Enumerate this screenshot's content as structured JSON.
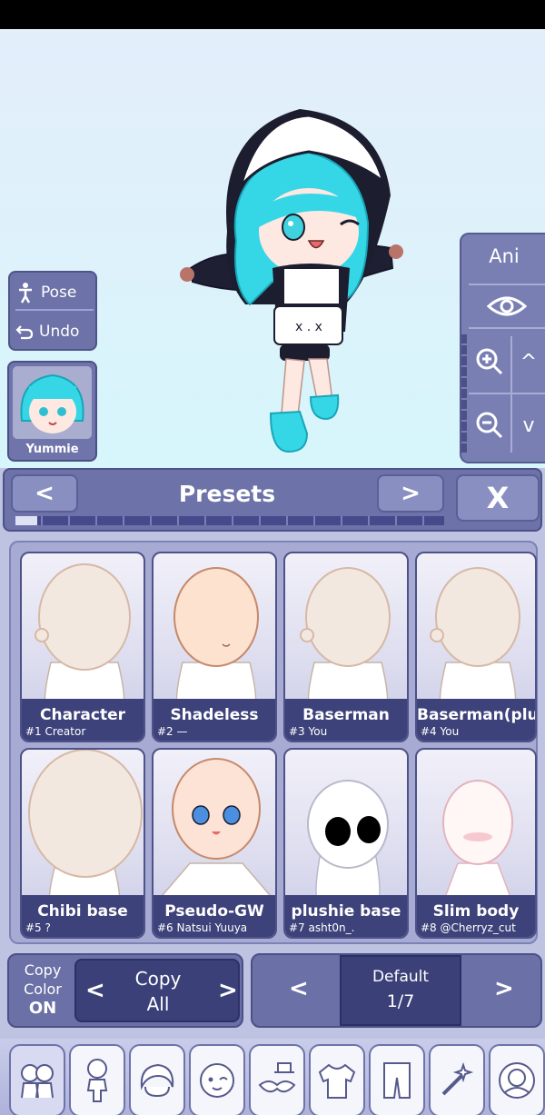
{
  "stage": {
    "pose_label": "Pose",
    "undo_label": "Undo",
    "character_name": "Yummie",
    "ani_label": "Ani",
    "up_glyph": "^",
    "down_glyph": "v"
  },
  "panel": {
    "title": "Presets",
    "prev_glyph": "<",
    "next_glyph": ">",
    "close_glyph": "X",
    "presets": [
      {
        "name": "Character",
        "num": "#1 Creator"
      },
      {
        "name": "Shadeless",
        "num": "#2 —"
      },
      {
        "name": "Baserman",
        "num": "#3 You"
      },
      {
        "name": "Baserman(plu",
        "num": "#4 You"
      },
      {
        "name": "Chibi base",
        "num": "#5 ?"
      },
      {
        "name": "Pseudo-GW",
        "num": "#6 Natsui Yuuya"
      },
      {
        "name": "plushie base",
        "num": "#7 asht0n_."
      },
      {
        "name": "Slim body",
        "num": "#8 @Cherryz_cut"
      }
    ]
  },
  "copy": {
    "copy_color_line1": "Copy",
    "copy_color_line2": "Color",
    "copy_color_state": "ON",
    "copy_all_line1": "Copy",
    "copy_all_line2": "All",
    "left_glyph": "<",
    "right_glyph": ">"
  },
  "default_selector": {
    "label": "Default",
    "page": "1/7",
    "left_glyph": "<",
    "right_glyph": ">"
  },
  "tabs": [
    "presets-tab-icon",
    "body-tab-icon",
    "hair-tab-icon",
    "face-tab-icon",
    "accessory-tab-icon",
    "clothing-tab-icon",
    "pants-tab-icon",
    "props-tab-icon",
    "profile-tab-icon"
  ],
  "colors": {
    "accent": "#6d72a8",
    "dark": "#3d427a",
    "hair": "#35d7e6"
  }
}
